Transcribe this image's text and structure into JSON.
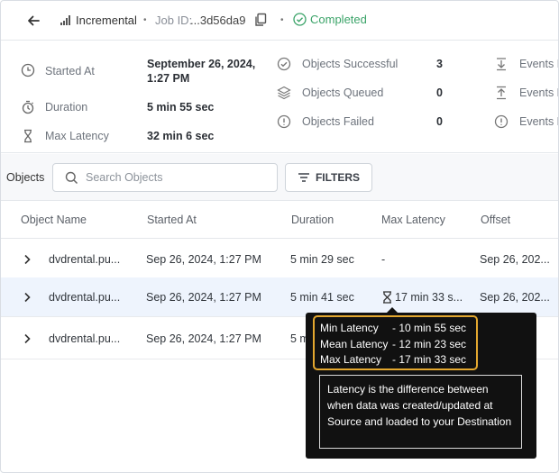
{
  "header": {
    "job_type": "Incremental",
    "job_id_label": "Job ID:",
    "job_id_value": "...3d56da9",
    "separator": "•",
    "status": "Completed"
  },
  "summary": {
    "col1": [
      {
        "label": "Started At",
        "value": "September 26, 2024,",
        "value2": "1:27 PM",
        "icon": "clock-icon"
      },
      {
        "label": "Duration",
        "value": "5 min 55 sec",
        "icon": "stopwatch-icon"
      },
      {
        "label": "Max Latency",
        "value": "32 min 6 sec",
        "icon": "hourglass-icon"
      }
    ],
    "col2": [
      {
        "label": "Objects Successful",
        "value": "3",
        "icon": "check-circle-icon"
      },
      {
        "label": "Objects Queued",
        "value": "0",
        "icon": "layers-icon"
      },
      {
        "label": "Objects Failed",
        "value": "0",
        "icon": "alert-circle-icon"
      }
    ],
    "col3": [
      {
        "label": "Events I",
        "icon": "download-icon"
      },
      {
        "label": "Events L",
        "icon": "upload-icon"
      },
      {
        "label": "Events F",
        "icon": "alert-circle-icon"
      }
    ]
  },
  "toolbar": {
    "label": "Objects",
    "search_placeholder": "Search Objects",
    "filters_label": "FILTERS"
  },
  "table": {
    "columns": [
      "Object Name",
      "Started At",
      "Duration",
      "Max Latency",
      "Offset"
    ],
    "rows": [
      {
        "name": "dvdrental.pu...",
        "started": "Sep 26, 2024, 1:27 PM",
        "duration": "5 min 29 sec",
        "latency": "-",
        "offset": "Sep 26, 202..."
      },
      {
        "name": "dvdrental.pu...",
        "started": "Sep 26, 2024, 1:27 PM",
        "duration": "5 min 41 sec",
        "latency": "17 min 33 s...",
        "offset": "Sep 26, 202..."
      },
      {
        "name": "dvdrental.pu...",
        "started": "Sep 26, 2024, 1:27 PM",
        "duration": "5 m",
        "latency": "",
        "offset": ""
      }
    ]
  },
  "tooltip": {
    "lines": [
      {
        "k": "Min Latency",
        "v": "- 10 min 55 sec"
      },
      {
        "k": "Mean Latency",
        "v": "- 12 min 23 sec"
      },
      {
        "k": "Max Latency",
        "v": "- 17 min 33 sec"
      }
    ],
    "description": "Latency is the difference between when data was created/updated at Source and loaded to your Destination"
  },
  "colors": {
    "success": "#3aa368",
    "highlight": "#e3a72f",
    "row_highlight": "#eef4fd"
  }
}
